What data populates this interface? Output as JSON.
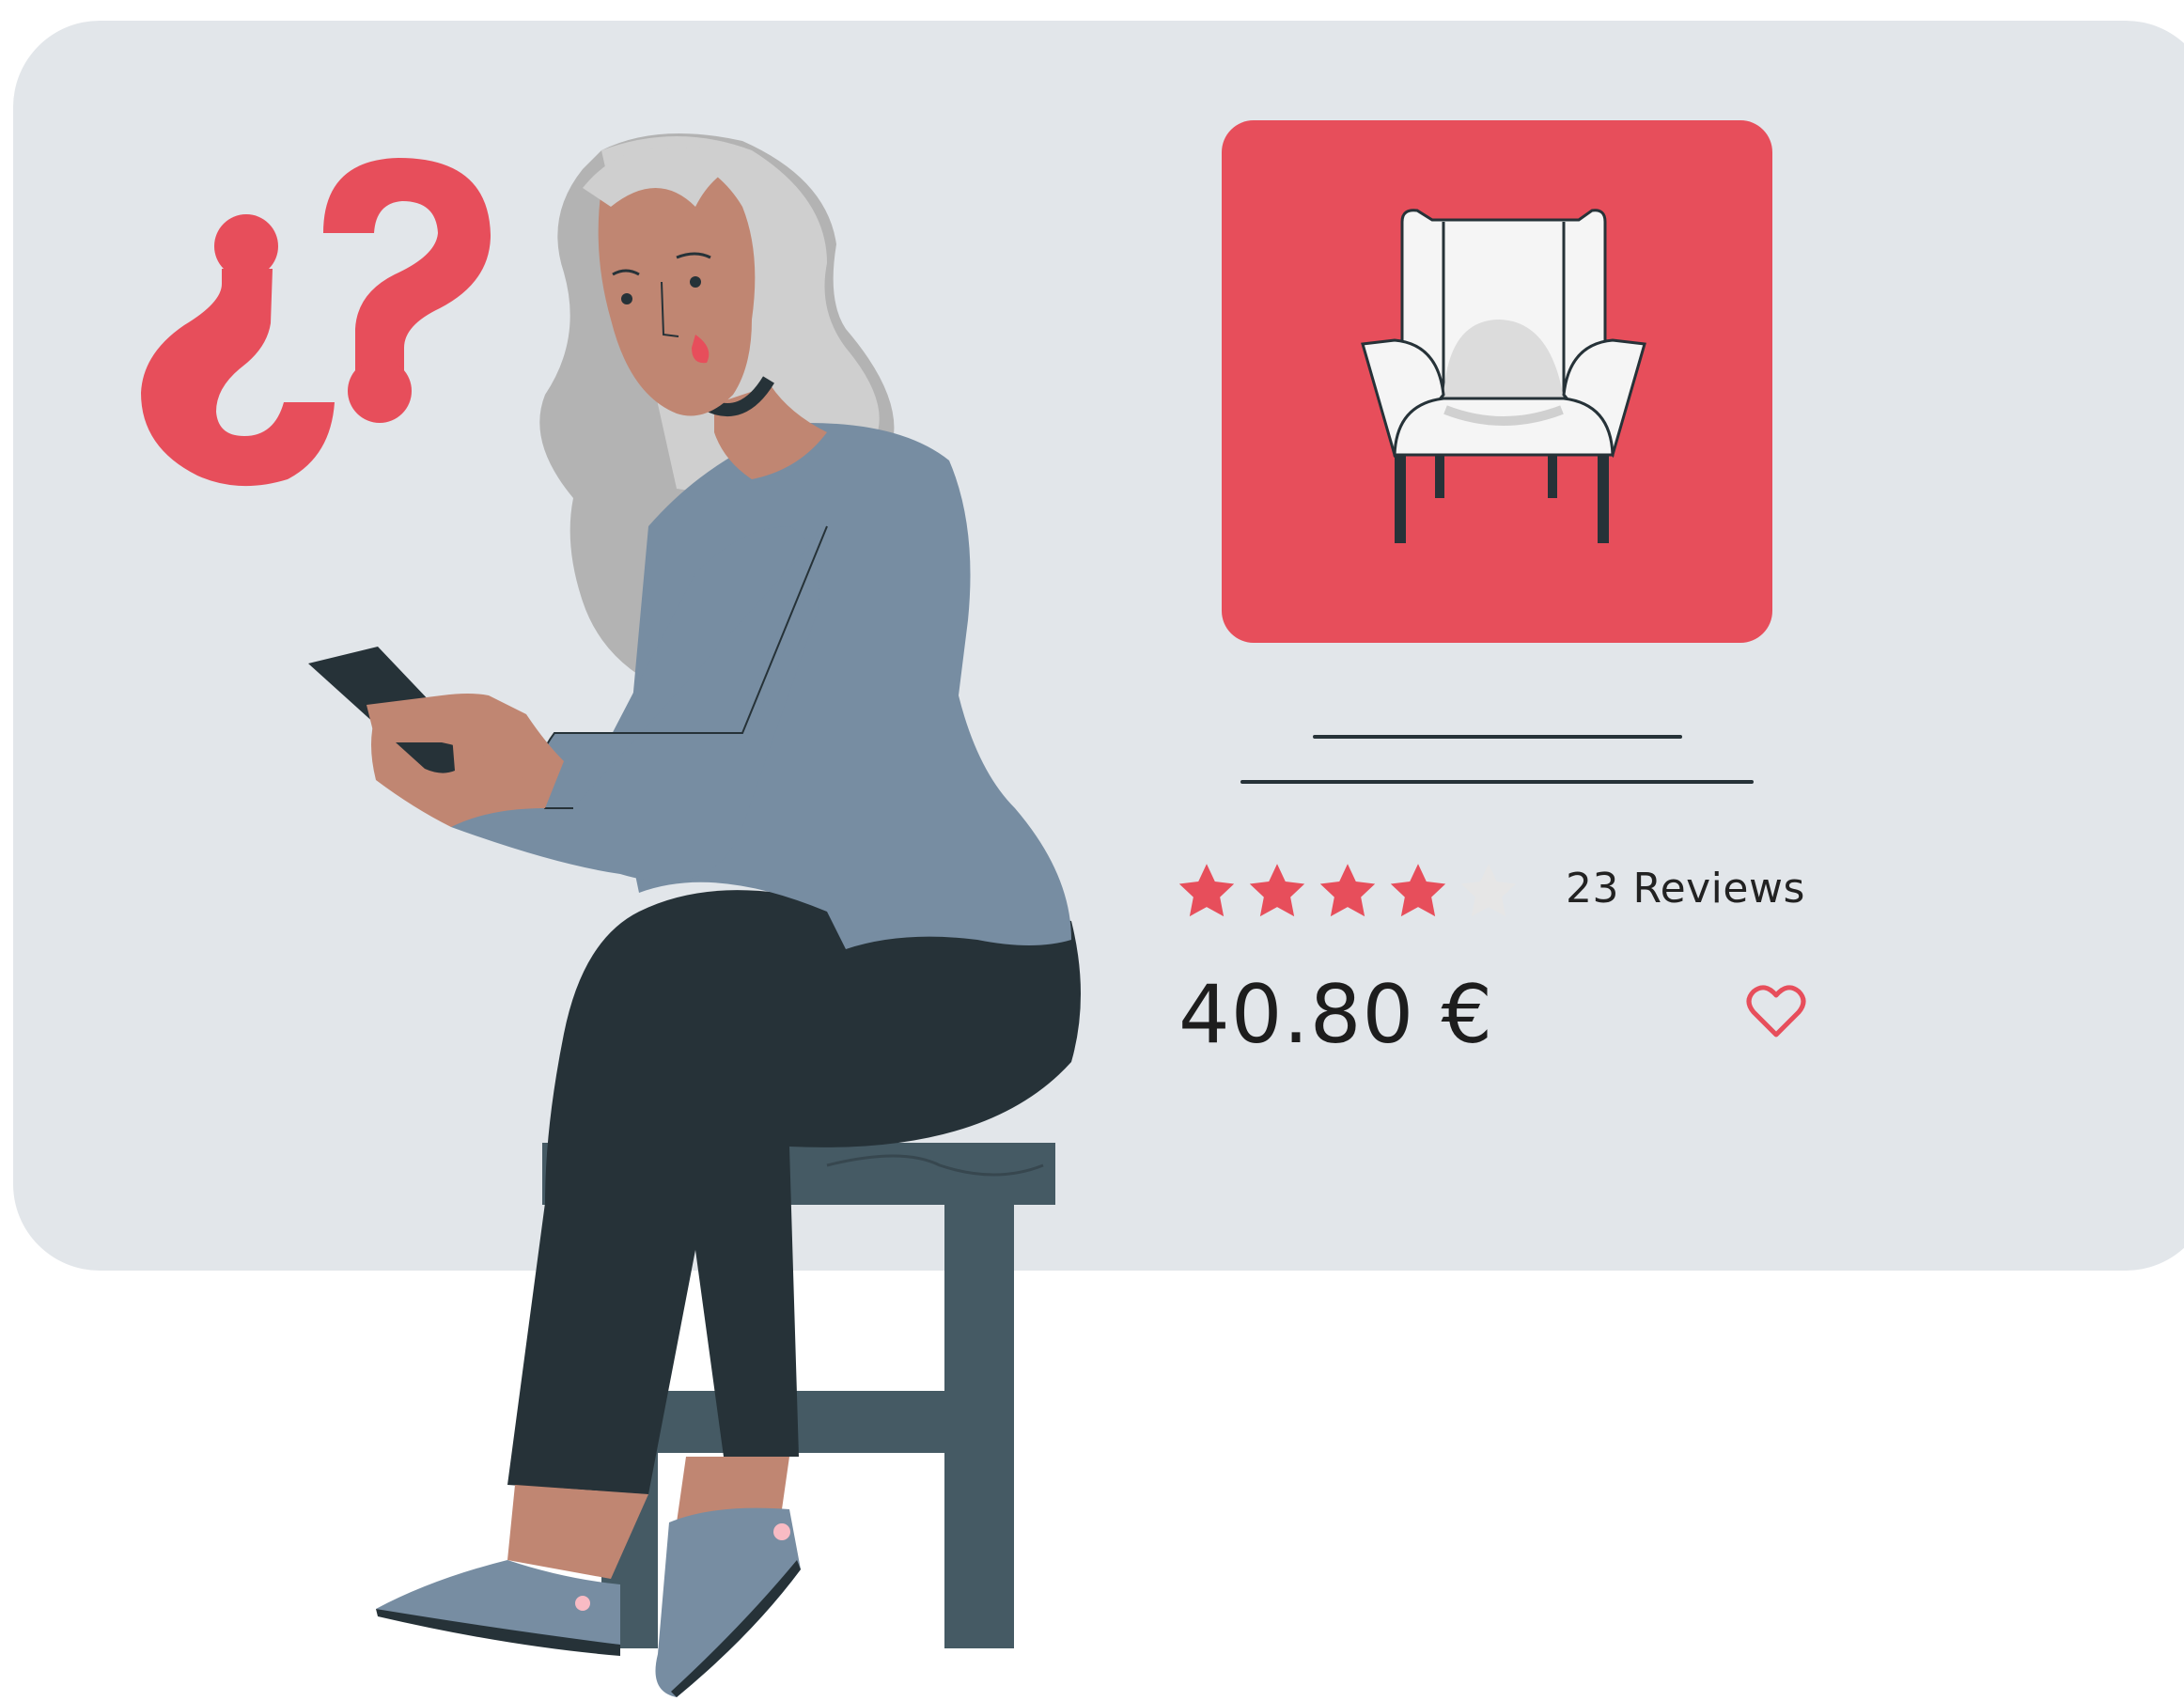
{
  "question_marks": "¿?",
  "product": {
    "image_icon": "armchair-icon",
    "rating": 4,
    "rating_max": 5,
    "reviews_label": "23 Reviews",
    "price": "40.80 €",
    "wishlist_icon": "heart-outline-icon"
  },
  "colors": {
    "background_card": "#e2e6ea",
    "accent": "#e74e5b",
    "star_active": "#e74e5b",
    "star_inactive": "#e6e6e6",
    "dark": "#263238",
    "shirt": "#778da2",
    "hair": "#c9c9c9",
    "skin": "#c08672"
  }
}
